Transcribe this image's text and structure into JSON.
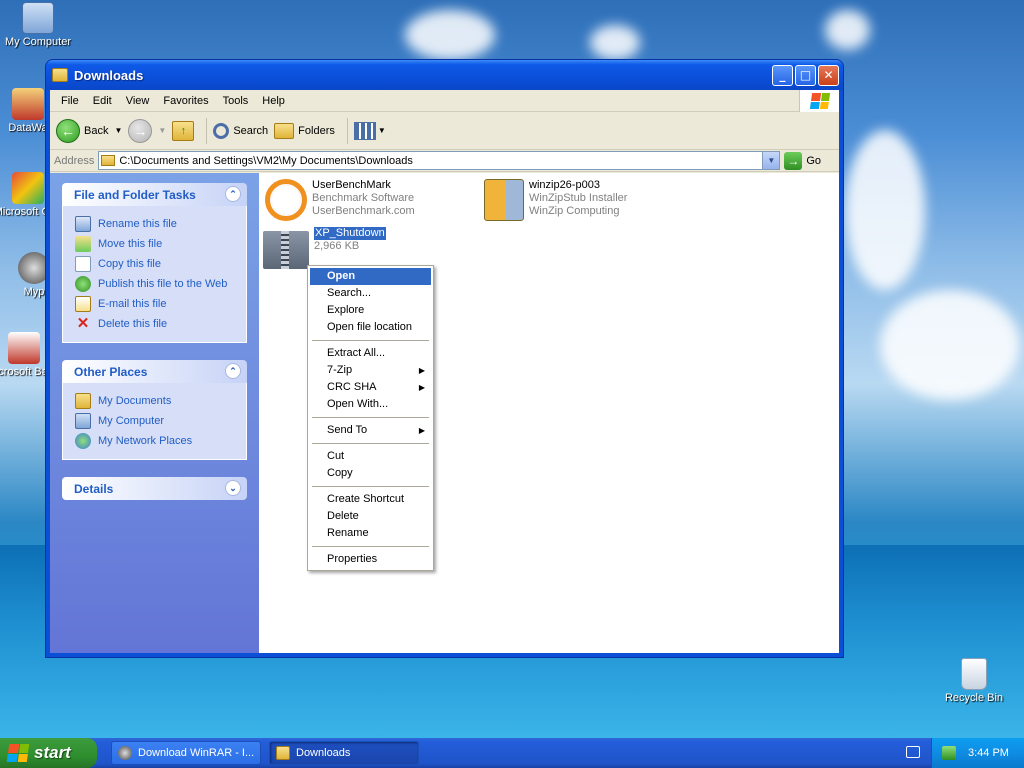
{
  "desktop": {
    "icons": [
      {
        "label": "My Computer"
      },
      {
        "label": "DataWa"
      },
      {
        "label": "Microsoft C++"
      },
      {
        "label": "Myp"
      },
      {
        "label": "Microsoft Basic"
      },
      {
        "label": "Recycle Bin"
      }
    ]
  },
  "window": {
    "title": "Downloads",
    "controls": {
      "minimize": "_",
      "maximize": "□",
      "close": "✕"
    }
  },
  "menubar": [
    "File",
    "Edit",
    "View",
    "Favorites",
    "Tools",
    "Help"
  ],
  "toolbar": {
    "back": "Back",
    "search": "Search",
    "folders": "Folders"
  },
  "address": {
    "label": "Address",
    "value": "C:\\Documents and Settings\\VM2\\My Documents\\Downloads",
    "go": "Go"
  },
  "tasks_panel": {
    "title": "File and Folder Tasks",
    "items": [
      "Rename this file",
      "Move this file",
      "Copy this file",
      "Publish this file to the Web",
      "E-mail this file",
      "Delete this file"
    ]
  },
  "places_panel": {
    "title": "Other Places",
    "items": [
      "My Documents",
      "My Computer",
      "My Network Places"
    ]
  },
  "details_panel": {
    "title": "Details"
  },
  "files": [
    {
      "name": "UserBenchMark",
      "line2": "Benchmark Software",
      "line3": "UserBenchmark.com"
    },
    {
      "name": "winzip26-p003",
      "line2": "WinZipStub Installer",
      "line3": "WinZip Computing"
    },
    {
      "name": "XP_Shutdown",
      "line2": "2,966 KB"
    }
  ],
  "context_menu": {
    "groups": [
      [
        "Open",
        "Search...",
        "Explore",
        "Open file location"
      ],
      [
        "Extract All...",
        "7-Zip",
        "CRC SHA",
        "Open With..."
      ],
      [
        "Send To"
      ],
      [
        "Cut",
        "Copy"
      ],
      [
        "Create Shortcut",
        "Delete",
        "Rename"
      ],
      [
        "Properties"
      ]
    ]
  },
  "taskbar": {
    "start": "start",
    "buttons": [
      "Download WinRAR - I...",
      "Downloads"
    ],
    "clock": "3:44 PM"
  }
}
